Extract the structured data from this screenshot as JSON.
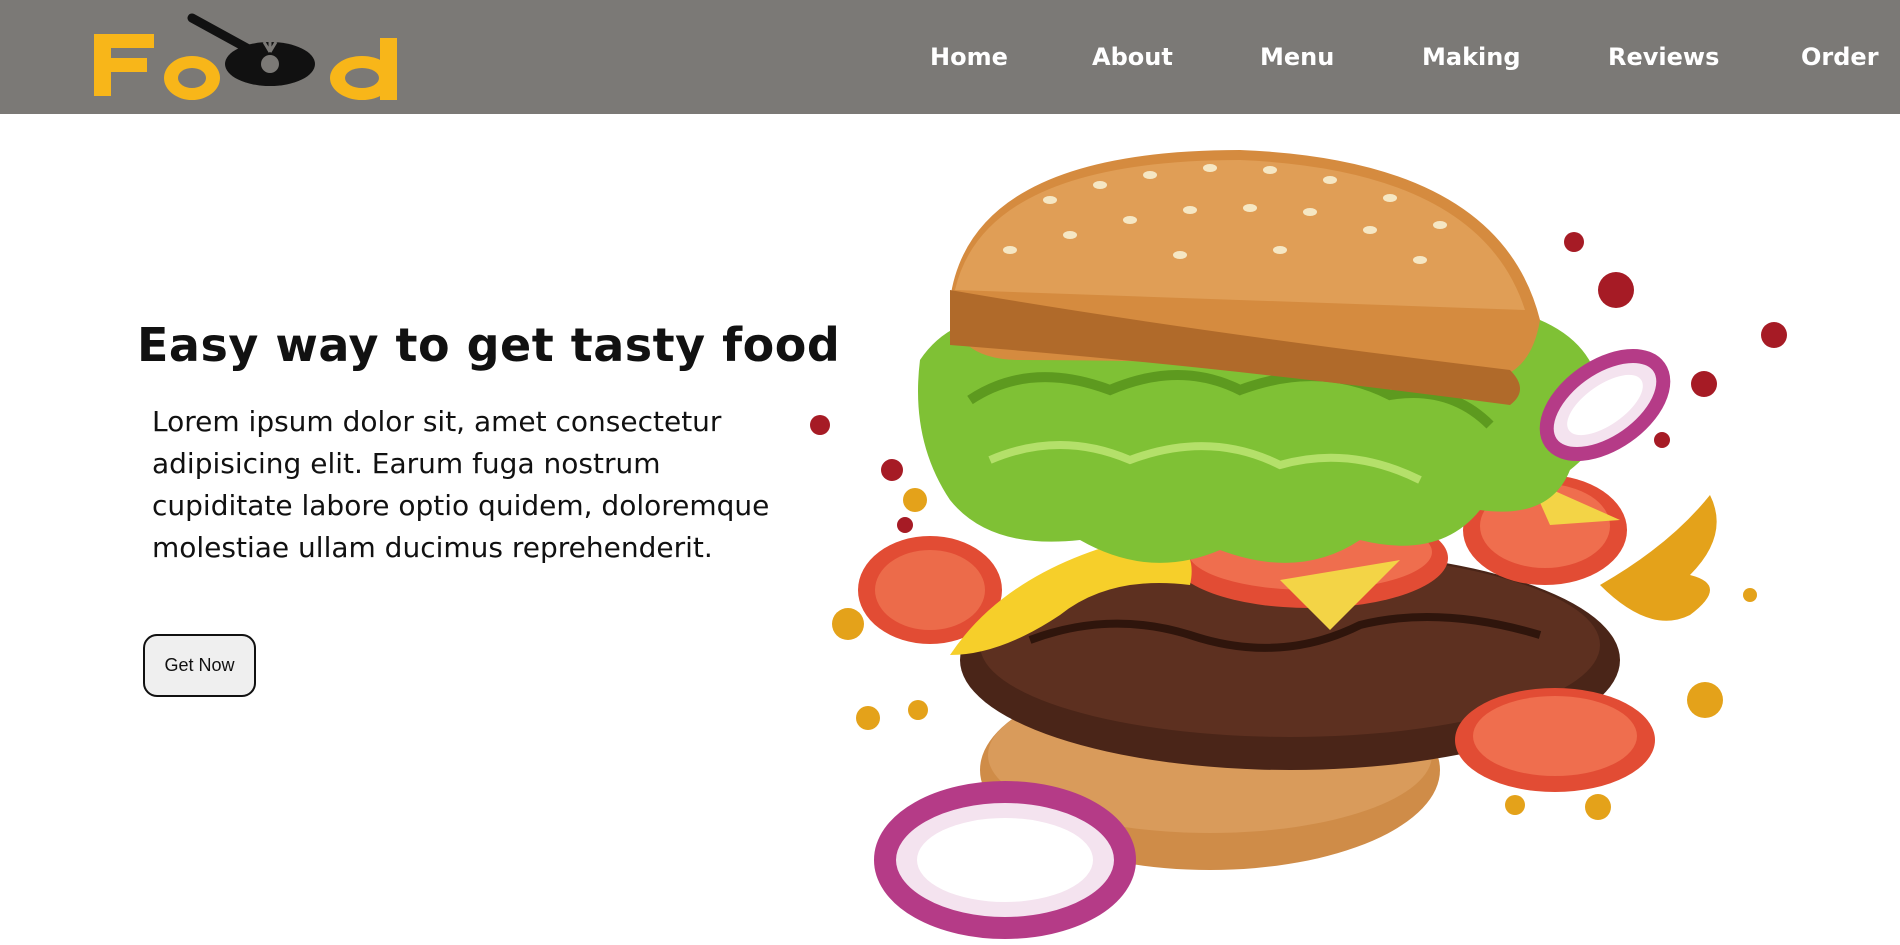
{
  "brand": {
    "logo_text": "Food",
    "logo_color": "#f8b619"
  },
  "nav": {
    "items": [
      {
        "label": "Home"
      },
      {
        "label": "About"
      },
      {
        "label": "Menu"
      },
      {
        "label": "Making"
      },
      {
        "label": "Reviews"
      },
      {
        "label": "Order"
      }
    ],
    "background": "#7b7976"
  },
  "hero": {
    "title": "Easy way to get tasty food",
    "text": "Lorem ipsum dolor sit, amet consectetur adipisicing elit. Earum fuga nostrum cupiditate labore optio quidem, doloremque molestiae ullam ducimus reprehenderit.",
    "button_label": "Get Now",
    "image_icon": "burger-image"
  }
}
